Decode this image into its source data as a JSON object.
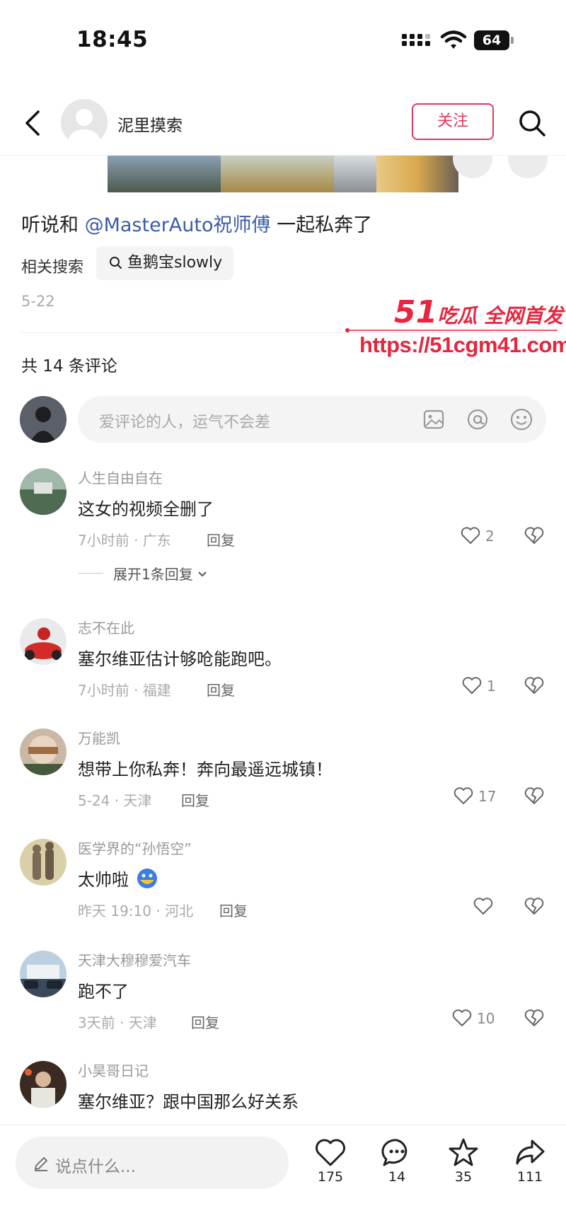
{
  "status_bar": {
    "time": "18:45",
    "battery": "64"
  },
  "header": {
    "author_name": "泥里摸索",
    "follow_label": "关注"
  },
  "post": {
    "caption_prefix": "听说和 ",
    "caption_mention": "@MasterAuto祝师傅",
    "caption_suffix": " 一起私奔了",
    "related_label": "相关搜索",
    "related_query": "鱼鹅宝slowly",
    "date": "5-22"
  },
  "watermark": {
    "brand_num": "51",
    "brand_text": "吃瓜 全网首发",
    "url": "https://51cgm41.com"
  },
  "comments_section": {
    "count_label": "共 14 条评论",
    "input_placeholder": "爱评论的人，运气不会差"
  },
  "comments": [
    {
      "name": "人生自由自在",
      "text": "这女的视频全删了",
      "meta": "7小时前 · 广东",
      "reply": "回复",
      "likes": "2",
      "expand": "展开1条回复"
    },
    {
      "name": "志不在此",
      "text": "塞尔维亚估计够呛能跑吧。",
      "meta": "7小时前 · 福建",
      "reply": "回复",
      "likes": "1"
    },
    {
      "name": "万能凯",
      "text": "想带上你私奔！奔向最遥远城镇！",
      "meta": "5-24 · 天津",
      "reply": "回复",
      "likes": "17"
    },
    {
      "name": "医学界的“孙悟空”",
      "text": "太帅啦",
      "meta": "昨天 19:10 · 河北",
      "reply": "回复",
      "likes": ""
    },
    {
      "name": "天津大穆穆爱汽车",
      "text": "跑不了",
      "meta": "3天前 · 天津",
      "reply": "回复",
      "likes": "10"
    },
    {
      "name": "小昊哥日记",
      "text": "塞尔维亚？跟中国那么好关系"
    }
  ],
  "bottom_bar": {
    "input_placeholder": "说点什么...",
    "likes": "175",
    "comments": "14",
    "favorites": "35",
    "shares": "111"
  },
  "colors": {
    "accent": "#e0395c",
    "mention": "#3a5da8",
    "watermark": "#e8243e"
  }
}
